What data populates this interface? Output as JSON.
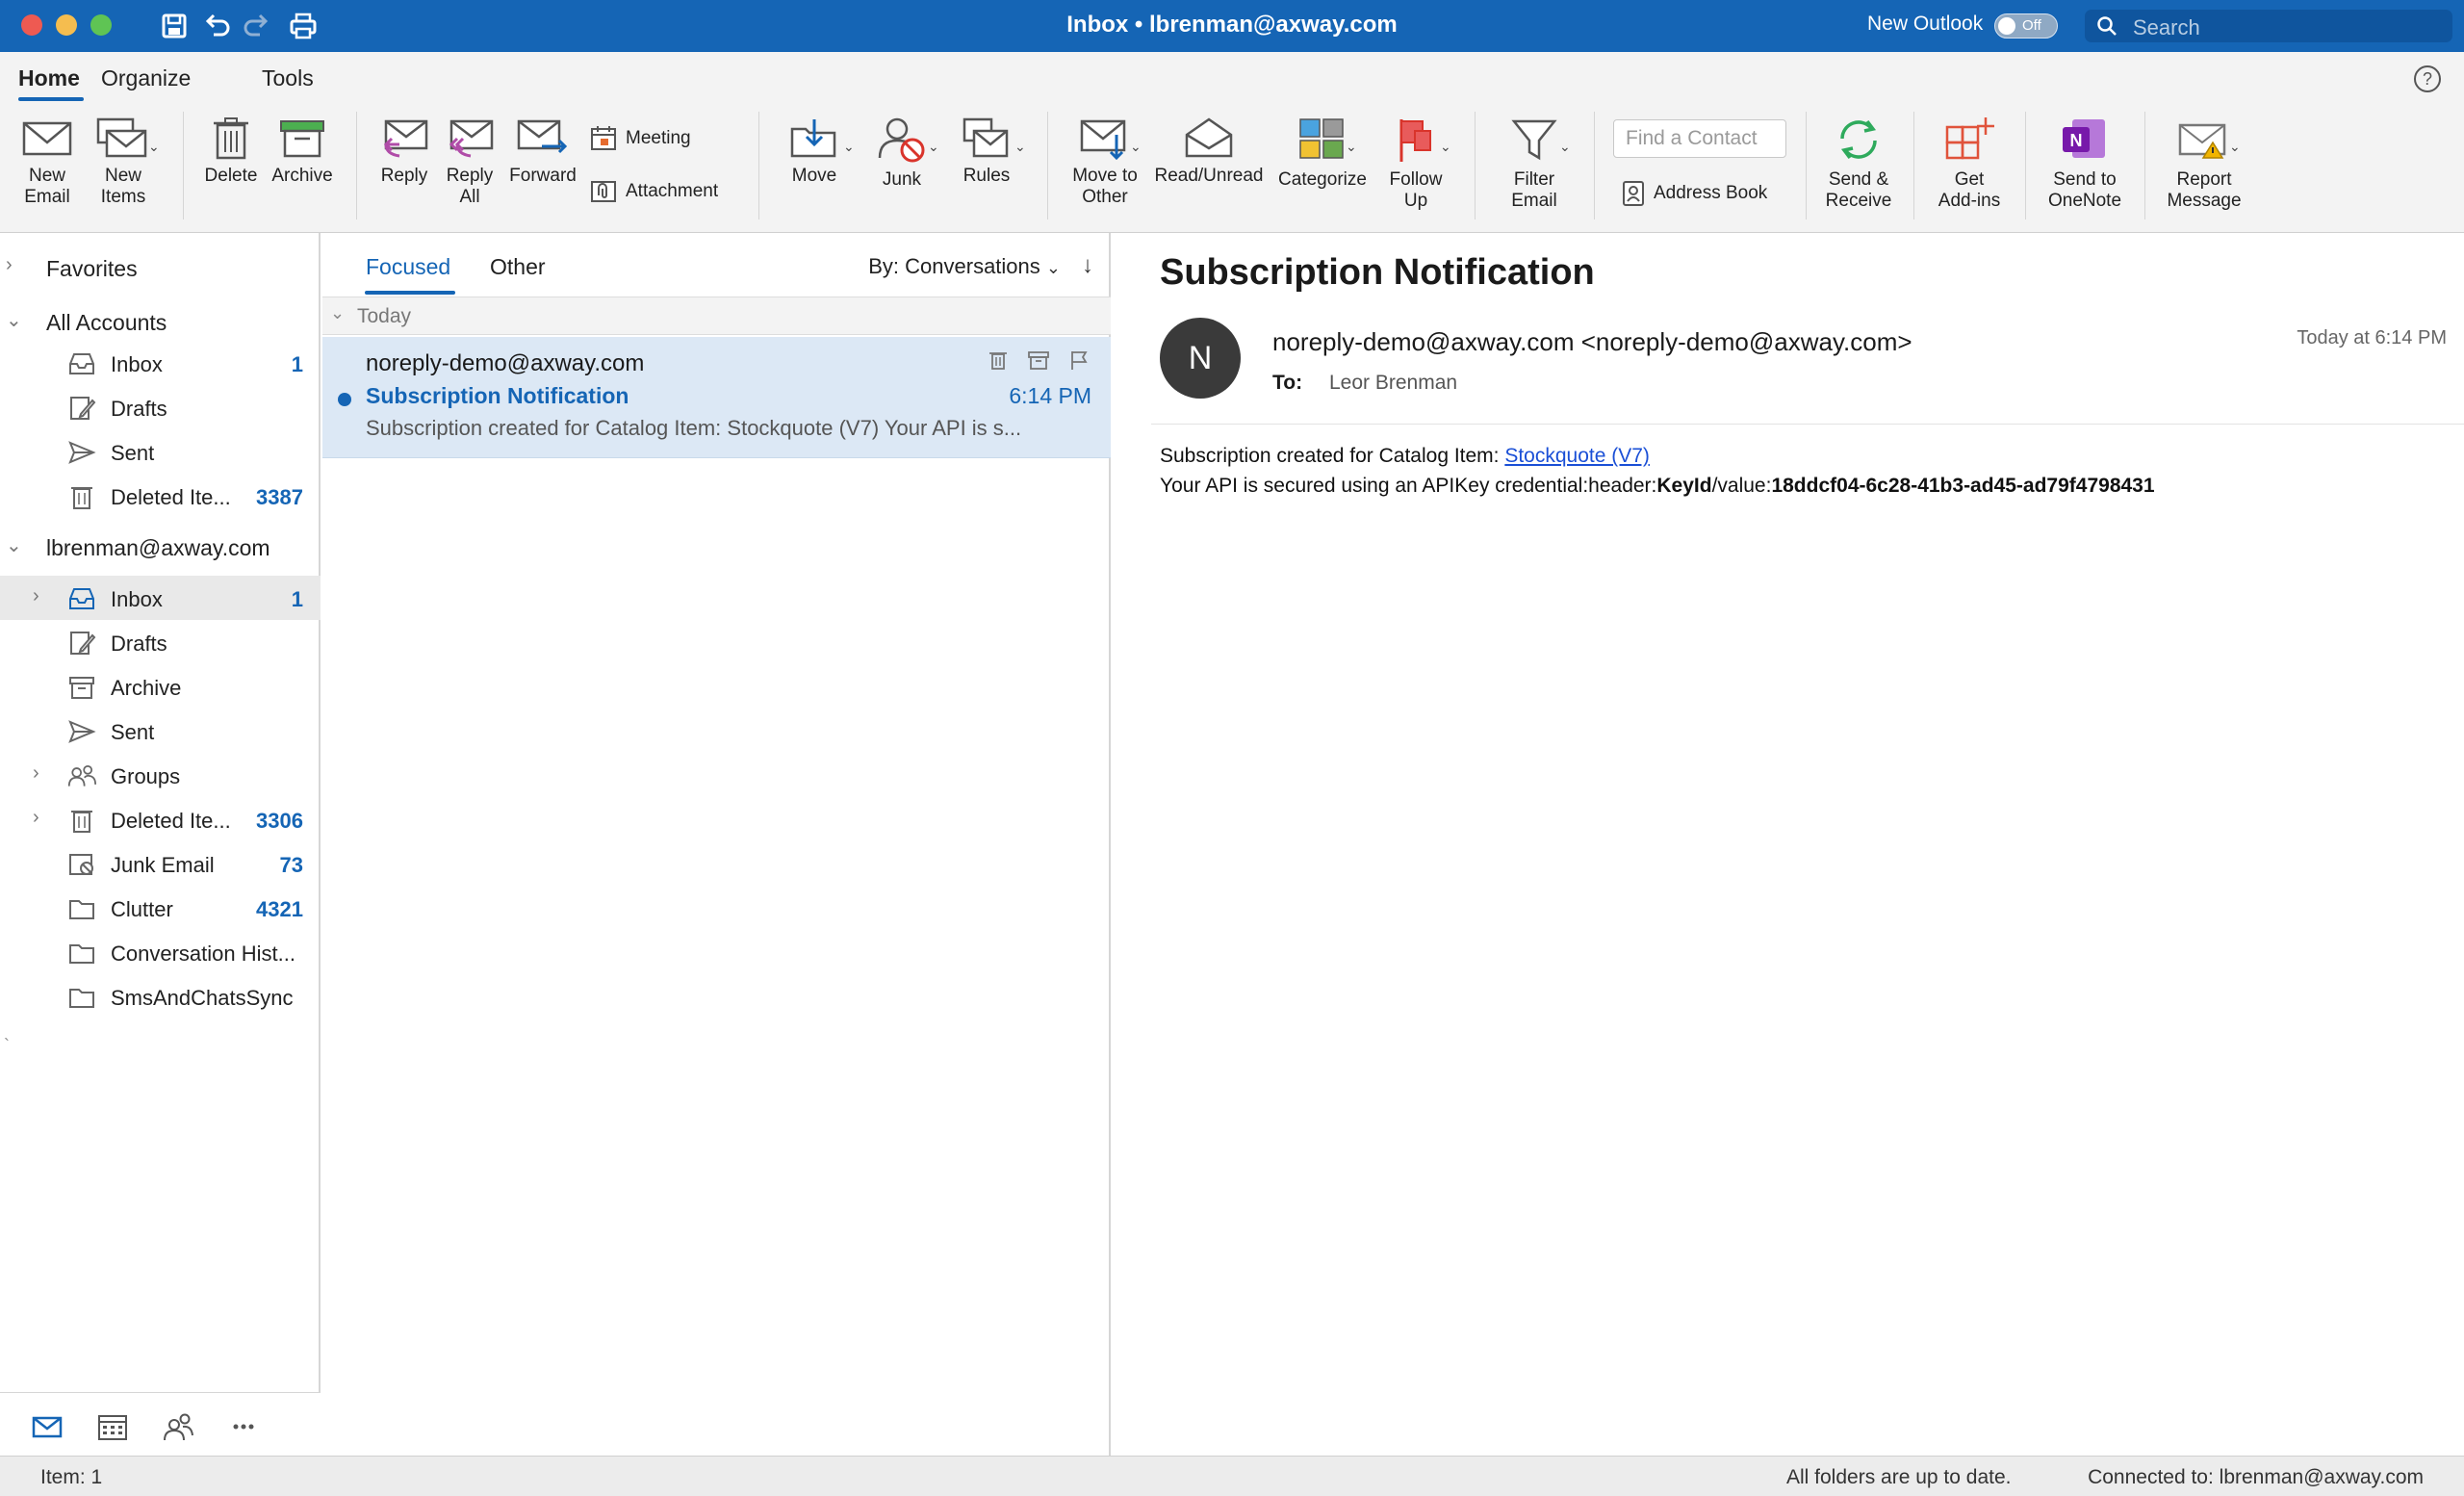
{
  "window": {
    "title": "Inbox • lbrenman@axway.com",
    "new_outlook_label": "New Outlook",
    "toggle_state": "Off",
    "search_placeholder": "Search"
  },
  "ribbon_tabs": [
    "Home",
    "Organize",
    "Tools"
  ],
  "ribbon": {
    "new_email": [
      "New",
      "Email"
    ],
    "new_items": [
      "New",
      "Items"
    ],
    "delete": "Delete",
    "archive": "Archive",
    "reply": "Reply",
    "reply_all": [
      "Reply",
      "All"
    ],
    "forward": "Forward",
    "meeting": "Meeting",
    "attachment": "Attachment",
    "move": "Move",
    "junk": "Junk",
    "rules": "Rules",
    "move_to_other": [
      "Move to",
      "Other"
    ],
    "read_unread": "Read/Unread",
    "categorize": "Categorize",
    "follow_up": [
      "Follow",
      "Up"
    ],
    "filter_email": [
      "Filter",
      "Email"
    ],
    "find_contact_placeholder": "Find a Contact",
    "address_book": "Address Book",
    "send_receive": [
      "Send &",
      "Receive"
    ],
    "get_addins": [
      "Get",
      "Add-ins"
    ],
    "send_to_onenote": [
      "Send to",
      "OneNote"
    ],
    "report_message": [
      "Report",
      "Message"
    ]
  },
  "sidebar": {
    "favorites": "Favorites",
    "all_accounts": "All Accounts",
    "all_accounts_items": [
      {
        "label": "Inbox",
        "count": "1"
      },
      {
        "label": "Drafts",
        "count": ""
      },
      {
        "label": "Sent",
        "count": ""
      },
      {
        "label": "Deleted Ite...",
        "count": "3387"
      }
    ],
    "account": "lbrenman@axway.com",
    "account_items": [
      {
        "label": "Inbox",
        "count": "1"
      },
      {
        "label": "Drafts",
        "count": ""
      },
      {
        "label": "Archive",
        "count": ""
      },
      {
        "label": "Sent",
        "count": ""
      },
      {
        "label": "Groups",
        "count": ""
      },
      {
        "label": "Deleted Ite...",
        "count": "3306"
      },
      {
        "label": "Junk Email",
        "count": "73"
      },
      {
        "label": "Clutter",
        "count": "4321"
      },
      {
        "label": "Conversation Hist...",
        "count": ""
      },
      {
        "label": "SmsAndChatsSync",
        "count": ""
      }
    ],
    "stray_mark": "`"
  },
  "message_list": {
    "tabs": [
      "Focused",
      "Other"
    ],
    "sort_label": "By: Conversations",
    "group_label": "Today",
    "item": {
      "sender": "noreply-demo@axway.com",
      "subject": "Subscription Notification",
      "time": "6:14 PM",
      "preview": "Subscription created for Catalog Item: Stockquote (V7) Your API is s..."
    }
  },
  "reading_pane": {
    "subject": "Subscription Notification",
    "avatar_initial": "N",
    "from": "noreply-demo@axway.com <noreply-demo@axway.com>",
    "to_label": "To:",
    "to": "Leor Brenman",
    "date": "Today at 6:14 PM",
    "body_line1_prefix": "Subscription created for Catalog Item: ",
    "body_link": "Stockquote (V7) ",
    "body_line2_prefix": "Your API is secured using an APIKey credential:header:",
    "body_key_label": "KeyId",
    "body_mid": "/value:",
    "body_key_value": "18ddcf04-6c28-41b3-ad45-ad79f4798431"
  },
  "status_bar": {
    "items": "Item: 1",
    "sync": "All folders are up to date.",
    "connection": "Connected to: lbrenman@axway.com"
  },
  "colors": {
    "accent": "#1565b5",
    "titlebar": "#1565b5",
    "selected_message": "#dce8f5",
    "link": "#1a4fd6"
  }
}
